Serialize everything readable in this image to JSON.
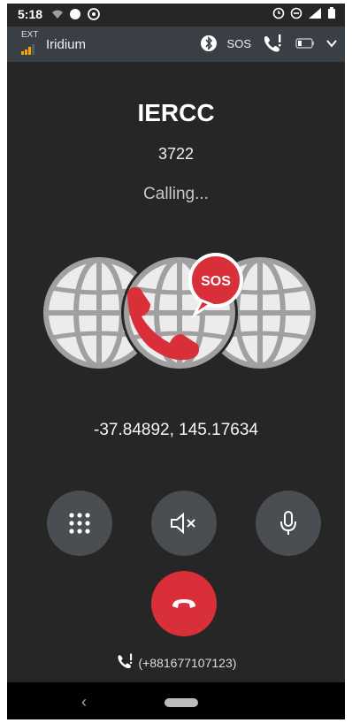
{
  "status_bar": {
    "time": "5:18",
    "icons": [
      "wifi-icon",
      "circle-icon",
      "whatsapp-icon",
      "clock-icon",
      "minus-circle-icon",
      "signal-icon",
      "battery-icon"
    ]
  },
  "app_bar": {
    "ext_label": "EXT",
    "network_name": "Iridium",
    "sos_label": "SOS",
    "icons": [
      "bluetooth-icon",
      "sos-call-icon",
      "battery-icon",
      "chevron-down-icon"
    ]
  },
  "call": {
    "contact_name": "IERCC",
    "contact_number": "3722",
    "status": "Calling...",
    "sos_badge": "SOS",
    "coordinates": "-37.84892, 145.17634",
    "caller_number": "(+881677107123)"
  },
  "controls": {
    "icons": [
      "dialpad-icon",
      "speaker-mute-icon",
      "microphone-icon",
      "end-call-icon"
    ]
  },
  "colors": {
    "background": "#262626",
    "appbar": "#3a3f45",
    "accent": "#d92f38",
    "control": "#4a4d52"
  }
}
